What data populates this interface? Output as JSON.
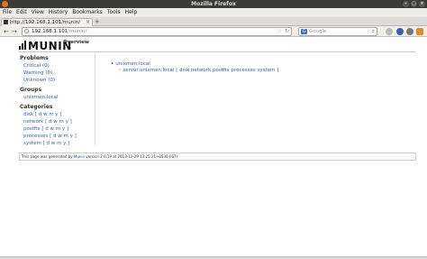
{
  "window": {
    "title": "Mozilla Firefox"
  },
  "menu": [
    "File",
    "Edit",
    "View",
    "History",
    "Bookmarks",
    "Tools",
    "Help"
  ],
  "tab": {
    "title": "http://192.168.1.101/munin/",
    "close": "×",
    "new_tab": "+"
  },
  "nav": {
    "back": "←",
    "forward": "→",
    "url_host": "192.168.1.101",
    "url_path": "/munin/",
    "search_placeholder": "Google",
    "search_engine": "G"
  },
  "page": {
    "logo_text": "MUNIN",
    "title": "Overview",
    "sidebar": {
      "problems_heading": "Problems",
      "problems": [
        "Critical (0)",
        "Warning (0)",
        "Unknown (0)"
      ],
      "groups_heading": "Groups",
      "groups": [
        "unixmen.local"
      ],
      "categories_heading": "Categories",
      "categories": [
        "disk [ d w m y ]",
        "network [ d w m y ]",
        "postfix [ d w m y ]",
        "processes [ d w m y ]",
        "system [ d w m y ]"
      ]
    },
    "main": {
      "group": "unixmen.local",
      "server_line": "server.unixmen.local [ disk  network  postfix  processes  system ]"
    },
    "footer": {
      "prefix": "This page was generated by ",
      "link": "Munin",
      "suffix": " version 2.0.19 at 2013-12-29 13:25:21+0530 (IST)"
    }
  },
  "colors": {
    "link": "#3a5ea8",
    "titlebar": "#3b3b38"
  }
}
